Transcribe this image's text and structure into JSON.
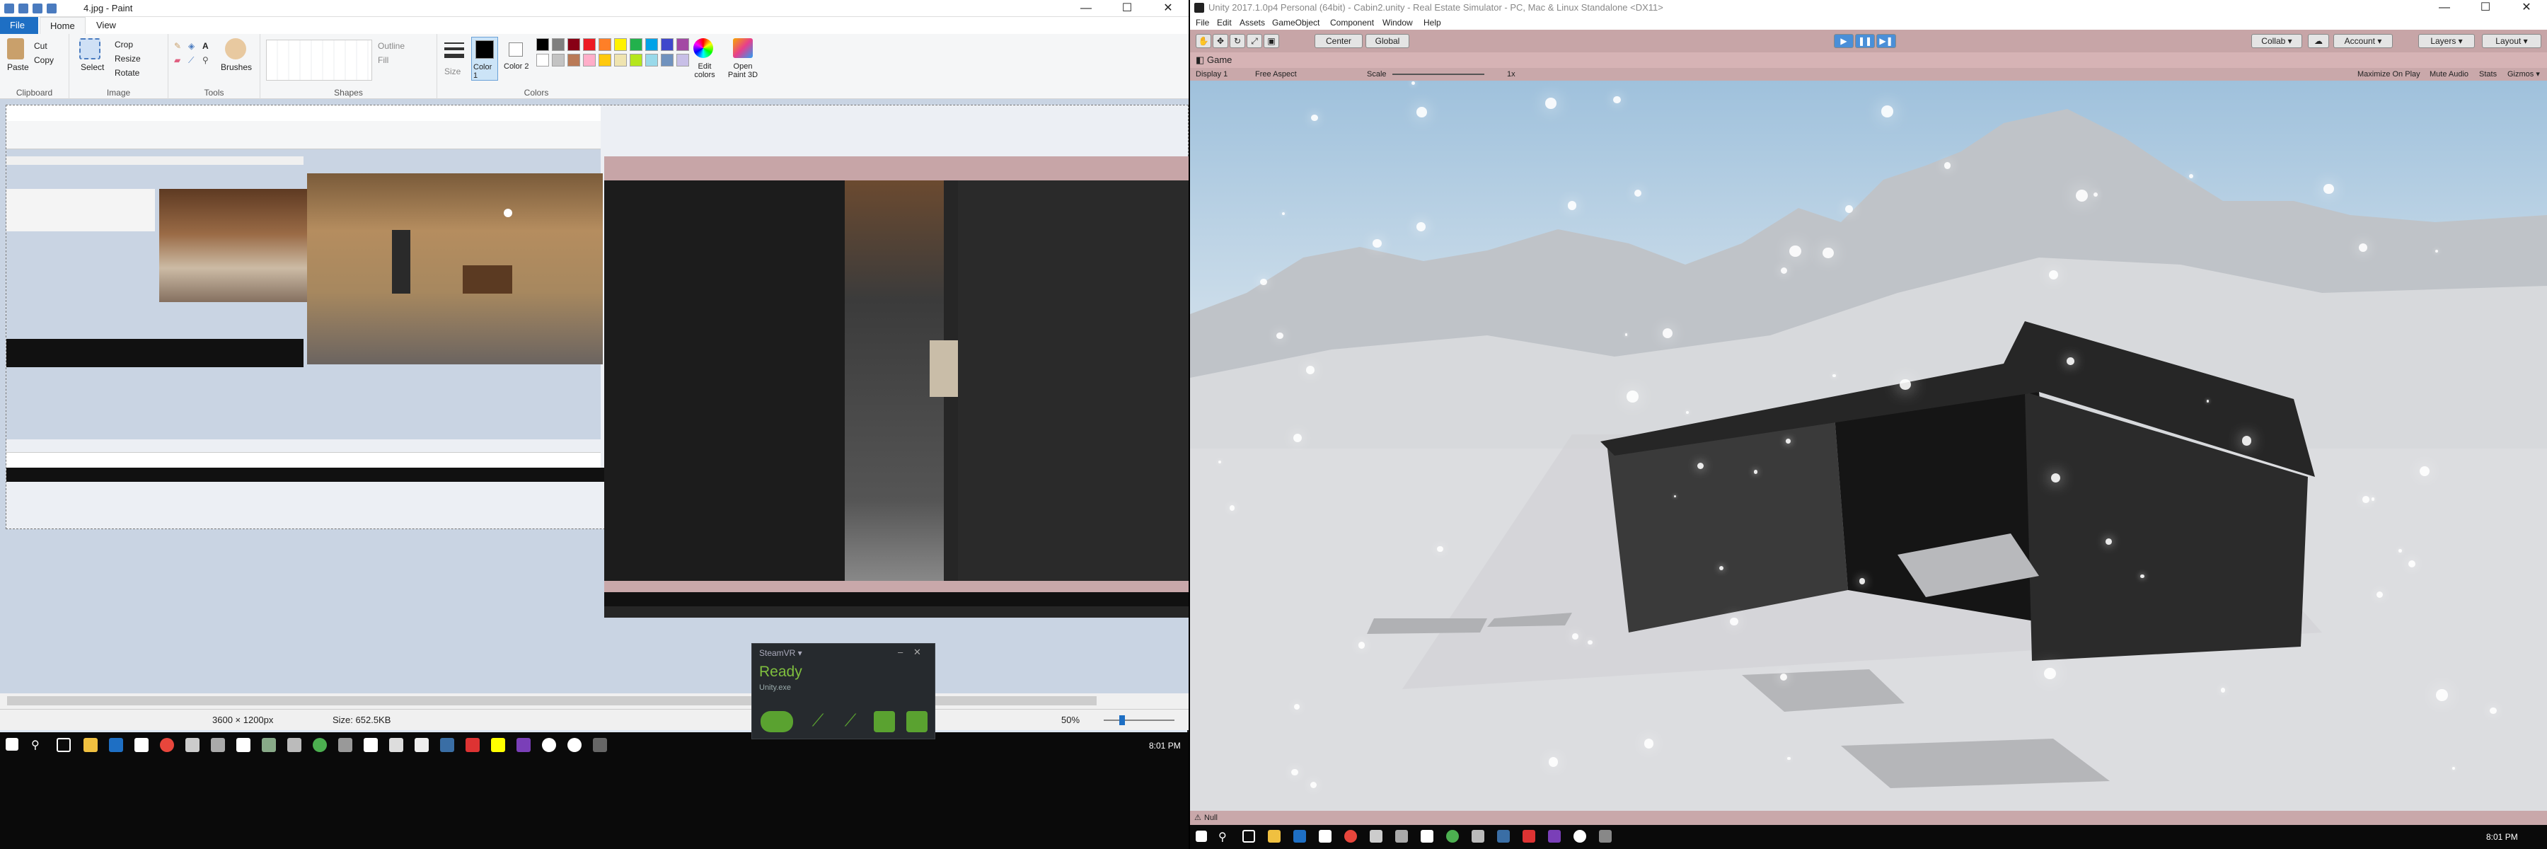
{
  "paint": {
    "title": "4.jpg - Paint",
    "tabs": {
      "file": "File",
      "home": "Home",
      "view": "View"
    },
    "ribbon": {
      "paste": "Paste",
      "cut": "Cut",
      "copy": "Copy",
      "select": "Select",
      "crop": "Crop",
      "resize": "Resize",
      "rotate": "Rotate",
      "brushes": "Brushes",
      "outline": "Outline",
      "fill": "Fill",
      "size": "Size",
      "color1": "Color 1",
      "color2": "Color 2",
      "edit_colors": "Edit colors",
      "open_paint3d": "Open Paint 3D",
      "groups": {
        "clipboard": "Clipboard",
        "image": "Image",
        "tools": "Tools",
        "shapes": "Shapes",
        "colors": "Colors"
      }
    },
    "palette": [
      "#000000",
      "#7f7f7f",
      "#880015",
      "#ed1c24",
      "#ff7f27",
      "#fff200",
      "#22b14c",
      "#00a2e8",
      "#3f48cc",
      "#a349a4",
      "#ffffff",
      "#c3c3c3",
      "#b97a57",
      "#ffaec9",
      "#ffc90e",
      "#efe4b0",
      "#b5e61d",
      "#99d9ea",
      "#7092be",
      "#c8bfe7"
    ],
    "status": {
      "dimensions": "3600 × 1200px",
      "size": "Size: 652.5KB",
      "zoom": "50%"
    }
  },
  "steamvr": {
    "header": "SteamVR ▾",
    "status": "Ready",
    "app": "Unity.exe"
  },
  "clock_left": "8:01 PM",
  "unity": {
    "title": "Unity 2017.1.0p4 Personal (64bit) - Cabin2.unity - Real Estate Simulator - PC, Mac & Linux Standalone <DX11>",
    "menu": [
      "File",
      "Edit",
      "Assets",
      "GameObject",
      "Component",
      "Window",
      "Help"
    ],
    "toolbar": {
      "center": "Center",
      "global": "Global",
      "collab": "Collab ▾",
      "account": "Account ▾",
      "layers": "Layers ▾",
      "layout": "Layout ▾"
    },
    "game_tab": "Game",
    "game_bar": {
      "display": "Display 1",
      "aspect": "Free Aspect",
      "scale_label": "Scale",
      "scale_value": "1x",
      "maximize": "Maximize On Play",
      "mute": "Mute Audio",
      "stats": "Stats",
      "gizmos": "Gizmos ▾"
    },
    "status_text": "Null",
    "clock": "8:01 PM"
  }
}
